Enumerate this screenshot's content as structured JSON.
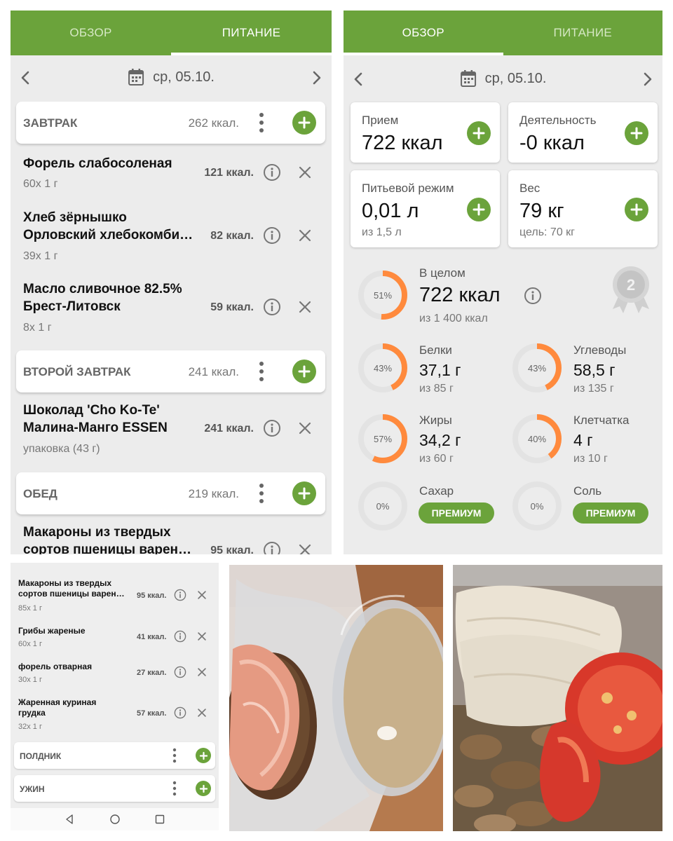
{
  "nutrition_screen": {
    "tabs": [
      "ОБЗОР",
      "ПИТАНИЕ"
    ],
    "active_tab": "ПИТАНИЕ",
    "date": "ср, 05.10.",
    "meals": [
      {
        "title": "ЗАВТРАК",
        "kcal": "262 ккал."
      },
      {
        "title": "ВТОРОЙ ЗАВТРАК",
        "kcal": "241 ккал."
      },
      {
        "title": "ОБЕД",
        "kcal": "219 ккал."
      }
    ],
    "foods": [
      {
        "name": "Форель слабосоленая",
        "portion": "60x 1 г",
        "kcal": "121 ккал."
      },
      {
        "name": "Хлеб зёрнышко Орловский хлебокомби…",
        "portion": "39x 1 г",
        "kcal": "82 ккал."
      },
      {
        "name": "Масло сливочное 82.5% Брест-Литовск",
        "portion": "8x 1 г",
        "kcal": "59 ккал."
      },
      {
        "name": "Шоколад 'Cho Ko-Te' Малина-Манго ESSEN",
        "portion": "упаковка (43 г)",
        "kcal": "241 ккал."
      },
      {
        "name": "Макароны из твердых сортов пшеницы варен…",
        "portion": "",
        "kcal": "95 ккал."
      }
    ]
  },
  "overview_screen": {
    "tabs": [
      "ОБЗОР",
      "ПИТАНИЕ"
    ],
    "active_tab": "ОБЗОР",
    "date": "ср, 05.10.",
    "cards": [
      {
        "label": "Прием",
        "value": "722 ккал",
        "sub": ""
      },
      {
        "label": "Деятельность",
        "value": "-0 ккал",
        "sub": ""
      },
      {
        "label": "Питьевой режим",
        "value": "0,01 л",
        "sub": "из 1,5 л"
      },
      {
        "label": "Вес",
        "value": "79 кг",
        "sub": "цель: 70 кг"
      }
    ],
    "total": {
      "label": "В целом",
      "value": "722 ккал",
      "sub": "из 1 400 ккал",
      "pct_label": "51%",
      "pct": 51
    },
    "medal_number": "2",
    "nutrients": [
      {
        "label": "Белки",
        "value": "37,1 г",
        "sub": "из 85 г",
        "pct_label": "43%",
        "pct": 43
      },
      {
        "label": "Углеводы",
        "value": "58,5 г",
        "sub": "из 135 г",
        "pct_label": "43%",
        "pct": 43
      },
      {
        "label": "Жиры",
        "value": "34,2 г",
        "sub": "из 60 г",
        "pct_label": "57%",
        "pct": 57
      },
      {
        "label": "Клетчатка",
        "value": "4 г",
        "sub": "из 10 г",
        "pct_label": "40%",
        "pct": 40
      },
      {
        "label": "Сахар",
        "premium": "ПРЕМИУМ",
        "pct_label": "0%",
        "pct": 0
      },
      {
        "label": "Соль",
        "premium": "ПРЕМИУМ",
        "pct_label": "0%",
        "pct": 0
      }
    ]
  },
  "small_screen": {
    "foods": [
      {
        "name": "Макароны из твердых сортов пшеницы варен…",
        "portion": "85x 1 г",
        "kcal": "95 ккал."
      },
      {
        "name": "Грибы жареные",
        "portion": "60x 1 г",
        "kcal": "41 ккал."
      },
      {
        "name": "форель отварная",
        "portion": "30x 1 г",
        "kcal": "27 ккал."
      },
      {
        "name": "Жаренная куриная грудка",
        "portion": "32x 1 г",
        "kcal": "57 ккал."
      }
    ],
    "meals": [
      {
        "title": "ПОЛДНИК"
      },
      {
        "title": "УЖИН"
      }
    ]
  },
  "colors": {
    "accent": "#6ba33b",
    "ring": "#ff8a3d",
    "ring_track": "#e3e3e3"
  },
  "icons": [
    "chevron-left-icon",
    "chevron-right-icon",
    "calendar-icon",
    "more-vert-icon",
    "plus-icon",
    "info-icon",
    "close-icon",
    "medal-icon",
    "nav-back-icon",
    "nav-home-icon",
    "nav-recents-icon"
  ]
}
